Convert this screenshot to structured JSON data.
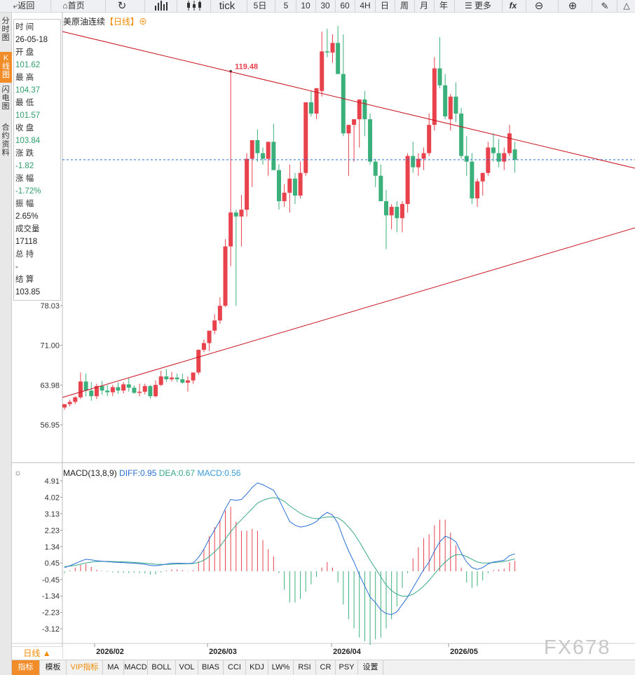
{
  "toolbar": {
    "back_label": "返回",
    "home_label": "首页",
    "tick_label": "tick",
    "period_5d": "5日",
    "p5": "5",
    "p10": "10",
    "p30": "30",
    "p60": "60",
    "p4h": "4H",
    "day": "日",
    "week": "周",
    "month": "月",
    "year": "年",
    "more": "更多",
    "fx": "fx"
  },
  "leftnav": {
    "timeshare": "分时图",
    "kline": "K线图",
    "flash": "闪电图",
    "contract": "合约资料"
  },
  "chart_title": {
    "name": "美原油连续",
    "period_tag": "【日线】",
    "plus": "⊕"
  },
  "info": {
    "time_label": "时 间",
    "time_value": "26-05-18",
    "open_label": "开 盘",
    "open_value": "101.62",
    "high_label": "最 高",
    "high_value": "104.37",
    "low_label": "最 低",
    "low_value": "101.57",
    "close_label": "收 盘",
    "close_value": "103.84",
    "change_label": "涨 跌",
    "change_value": "-1.82",
    "pct_label": "涨 幅",
    "pct_value": "-1.72%",
    "amp_label": "振 幅",
    "amp_value": "2.65%",
    "vol_label": "成交量",
    "vol_value": "17118",
    "oi_label": "总 持",
    "oi_value": "-",
    "settle_label": "结 算",
    "settle_value": "103.85"
  },
  "price_axis": [
    "78.03",
    "71.00",
    "63.98",
    "56.95"
  ],
  "max_label": "119.48",
  "macd_title": {
    "name": "MACD(13,8,9)",
    "diff": "DIFF:0.95",
    "dea": "DEA:0.67",
    "macd": "MACD:0.56"
  },
  "macd_axis": [
    "4.91",
    "4.02",
    "3.13",
    "2.23",
    "1.34",
    "0.45",
    "-0.45",
    "-1.34",
    "-2.23",
    "-3.12"
  ],
  "x_axis": [
    "2026/02",
    "2026/03",
    "2026/04",
    "2026/05"
  ],
  "bottom": {
    "day_line": "日线 ▲",
    "tabs": [
      "指标",
      "模板",
      "VIP指标",
      "MA",
      "MACD",
      "BOLL",
      "VOL",
      "BIAS",
      "CCI",
      "KDJ",
      "LW%",
      "RSI",
      "CR",
      "PSY",
      "设置"
    ]
  },
  "watermark": "FX678",
  "colors": {
    "up": "#e8424d",
    "down": "#3bb07a",
    "trend": "#c9121f",
    "diff": "#2a6fd6",
    "dea": "#37a88a",
    "accent": "#f28c28"
  },
  "chart_data": {
    "type": "candlestick",
    "candles": [
      [
        60.0,
        60.6,
        59.6,
        60.6
      ],
      [
        60.6,
        61.4,
        60.2,
        61.0
      ],
      [
        61.0,
        62.0,
        60.6,
        61.8
      ],
      [
        61.8,
        66.2,
        61.5,
        64.6
      ],
      [
        64.6,
        66.0,
        62.0,
        63.0
      ],
      [
        63.0,
        64.5,
        61.2,
        62.0
      ],
      [
        62.0,
        64.2,
        61.5,
        63.8
      ],
      [
        63.8,
        64.7,
        62.3,
        63.0
      ],
      [
        63.0,
        64.0,
        62.0,
        62.7
      ],
      [
        62.7,
        64.0,
        62.0,
        63.6
      ],
      [
        63.6,
        64.4,
        62.4,
        63.0
      ],
      [
        63.0,
        64.5,
        62.5,
        64.1
      ],
      [
        64.1,
        65.2,
        62.8,
        63.5
      ],
      [
        63.5,
        63.9,
        62.4,
        62.6
      ],
      [
        62.6,
        64.2,
        62.0,
        62.8
      ],
      [
        62.8,
        64.2,
        62.3,
        63.8
      ],
      [
        63.8,
        64.0,
        61.6,
        62.0
      ],
      [
        62.0,
        64.8,
        61.8,
        64.0
      ],
      [
        64.0,
        66.5,
        63.8,
        65.5
      ],
      [
        65.5,
        66.8,
        64.5,
        65.0
      ],
      [
        65.0,
        66.3,
        64.6,
        65.3
      ],
      [
        65.3,
        66.0,
        64.5,
        65.0
      ],
      [
        65.0,
        66.0,
        64.2,
        64.4
      ],
      [
        64.4,
        65.5,
        62.8,
        64.8
      ],
      [
        64.8,
        66.0,
        64.2,
        66.2
      ],
      [
        66.2,
        70.3,
        65.8,
        70.2
      ],
      [
        70.2,
        72.0,
        69.8,
        71.4
      ],
      [
        71.4,
        72.2,
        70.0,
        73.6
      ],
      [
        73.6,
        76.5,
        73.0,
        75.4
      ],
      [
        75.4,
        79.5,
        74.8,
        78.0
      ],
      [
        78.0,
        89.8,
        77.8,
        88.5
      ],
      [
        88.5,
        119.48,
        85.0,
        94.5
      ],
      [
        94.5,
        95.0,
        78.0,
        93.8
      ],
      [
        93.8,
        97.6,
        88.5,
        95.0
      ],
      [
        95.0,
        105.0,
        93.8,
        104.0
      ],
      [
        104.0,
        106.5,
        99.0,
        107.3
      ],
      [
        107.3,
        109.2,
        103.5,
        105.0
      ],
      [
        105.0,
        106.0,
        103.0,
        104.0
      ],
      [
        104.0,
        107.0,
        101.0,
        107.0
      ],
      [
        107.0,
        110.2,
        103.5,
        102.0
      ],
      [
        102.0,
        103.0,
        95.0,
        96.5
      ],
      [
        96.5,
        99.5,
        95.5,
        98.0
      ],
      [
        98.0,
        103.0,
        94.5,
        100.5
      ],
      [
        100.5,
        101.5,
        96.0,
        97.5
      ],
      [
        97.5,
        103.5,
        97.0,
        101.5
      ],
      [
        101.5,
        110.0,
        101.0,
        114.0
      ],
      [
        114.0,
        116.0,
        111.5,
        112.0
      ],
      [
        112.0,
        116.0,
        111.0,
        116.5
      ],
      [
        116.0,
        126.5,
        115.0,
        123.0
      ],
      [
        123.0,
        127.0,
        122.0,
        122.8
      ],
      [
        122.8,
        126.0,
        121.0,
        124.5
      ],
      [
        124.5,
        127.5,
        123.0,
        119.0
      ],
      [
        119.0,
        126.0,
        108.0,
        108.5
      ],
      [
        108.5,
        110.0,
        101.0,
        110.0
      ],
      [
        110.0,
        111.0,
        103.5,
        111.0
      ],
      [
        111.0,
        114.0,
        106.0,
        114.5
      ],
      [
        114.5,
        116.0,
        108.0,
        111.0
      ],
      [
        111.0,
        112.0,
        103.0,
        103.5
      ],
      [
        103.5,
        104.0,
        99.0,
        101.0
      ],
      [
        101.0,
        103.0,
        96.5,
        96.5
      ],
      [
        96.5,
        98.5,
        88.0,
        94.0
      ],
      [
        94.0,
        96.0,
        91.5,
        95.5
      ],
      [
        95.5,
        96.5,
        91.0,
        93.5
      ],
      [
        93.5,
        96.5,
        91.0,
        96.0
      ],
      [
        96.0,
        105.0,
        94.5,
        104.5
      ],
      [
        104.5,
        107.0,
        101.5,
        102.5
      ],
      [
        102.5,
        105.0,
        101.0,
        104.0
      ],
      [
        104.0,
        106.0,
        102.0,
        105.0
      ],
      [
        105.0,
        112.0,
        104.5,
        110.0
      ],
      [
        110.0,
        122.0,
        109.0,
        120.0
      ],
      [
        120.0,
        125.5,
        116.5,
        117.0
      ],
      [
        117.0,
        119.0,
        111.0,
        111.5
      ],
      [
        111.0,
        115.5,
        109.0,
        115.0
      ],
      [
        115.0,
        117.5,
        110.5,
        112.0
      ],
      [
        112.0,
        113.0,
        104.0,
        104.5
      ],
      [
        104.5,
        108.0,
        101.0,
        103.5
      ],
      [
        103.5,
        105.0,
        96.0,
        97.0
      ],
      [
        97.0,
        100.5,
        95.5,
        100.0
      ],
      [
        100.0,
        101.5,
        97.5,
        101.5
      ],
      [
        101.5,
        107.0,
        101.0,
        106.0
      ],
      [
        106.0,
        108.5,
        103.5,
        105.0
      ],
      [
        105.0,
        107.5,
        102.5,
        103.5
      ],
      [
        103.5,
        106.0,
        102.0,
        105.0
      ],
      [
        105.0,
        110.0,
        104.5,
        108.5
      ],
      [
        105.66,
        107.0,
        101.57,
        103.84
      ]
    ],
    "macd": {
      "diff": [
        0.2,
        0.3,
        0.42,
        0.55,
        0.65,
        0.62,
        0.57,
        0.55,
        0.52,
        0.5,
        0.48,
        0.47,
        0.45,
        0.44,
        0.41,
        0.38,
        0.32,
        0.3,
        0.34,
        0.39,
        0.43,
        0.44,
        0.43,
        0.42,
        0.45,
        0.75,
        1.2,
        1.75,
        2.25,
        2.75,
        3.4,
        3.9,
        3.85,
        3.9,
        4.2,
        4.55,
        4.8,
        4.7,
        4.55,
        4.4,
        3.9,
        3.3,
        2.7,
        2.5,
        2.4,
        2.45,
        2.55,
        2.7,
        3.0,
        3.2,
        3.05,
        2.6,
        1.8,
        1.1,
        0.5,
        -0.2,
        -0.8,
        -1.4,
        -1.7,
        -2.1,
        -2.3,
        -2.35,
        -2.2,
        -1.8,
        -1.4,
        -0.9,
        -0.4,
        0.1,
        0.5,
        1.1,
        1.6,
        1.9,
        1.8,
        1.6,
        1.0,
        0.5,
        0.2,
        0.1,
        0.2,
        0.4,
        0.5,
        0.55,
        0.6,
        0.85,
        0.95
      ],
      "dea": [
        0.25,
        0.28,
        0.32,
        0.38,
        0.45,
        0.5,
        0.53,
        0.54,
        0.54,
        0.53,
        0.52,
        0.51,
        0.5,
        0.48,
        0.46,
        0.44,
        0.41,
        0.38,
        0.37,
        0.37,
        0.38,
        0.39,
        0.4,
        0.41,
        0.42,
        0.48,
        0.6,
        0.8,
        1.05,
        1.35,
        1.75,
        2.15,
        2.5,
        2.8,
        3.1,
        3.4,
        3.7,
        3.85,
        3.95,
        4.0,
        3.95,
        3.8,
        3.55,
        3.35,
        3.15,
        3.0,
        2.9,
        2.85,
        2.9,
        2.95,
        2.95,
        2.9,
        2.7,
        2.4,
        2.05,
        1.6,
        1.1,
        0.6,
        0.15,
        -0.3,
        -0.75,
        -1.05,
        -1.25,
        -1.35,
        -1.35,
        -1.25,
        -1.05,
        -0.8,
        -0.5,
        -0.15,
        0.2,
        0.5,
        0.75,
        0.9,
        0.9,
        0.8,
        0.65,
        0.5,
        0.45,
        0.45,
        0.47,
        0.5,
        0.53,
        0.6,
        0.67
      ],
      "hist": [
        -0.1,
        0.04,
        0.2,
        0.34,
        0.4,
        0.24,
        0.08,
        0.02,
        -0.04,
        -0.06,
        -0.08,
        -0.08,
        -0.1,
        -0.08,
        -0.1,
        -0.12,
        -0.18,
        -0.16,
        -0.06,
        0.04,
        0.1,
        0.1,
        0.06,
        0.02,
        0.06,
        0.54,
        1.2,
        1.9,
        2.4,
        2.8,
        3.3,
        3.5,
        2.7,
        2.2,
        2.2,
        2.3,
        2.2,
        1.7,
        1.2,
        0.8,
        -0.1,
        -1.0,
        -1.7,
        -1.7,
        -1.5,
        -1.1,
        -0.7,
        -0.3,
        0.2,
        0.5,
        0.2,
        -0.6,
        -1.8,
        -2.6,
        -3.1,
        -3.6,
        -3.8,
        -4.0,
        -3.7,
        -3.6,
        -3.1,
        -2.6,
        -1.9,
        -0.9,
        -0.1,
        0.7,
        1.3,
        1.8,
        2.0,
        2.5,
        2.8,
        2.8,
        2.1,
        1.4,
        0.2,
        -0.6,
        -0.9,
        -0.8,
        -0.5,
        -0.1,
        0.06,
        0.1,
        0.14,
        0.5,
        0.56
      ]
    }
  }
}
